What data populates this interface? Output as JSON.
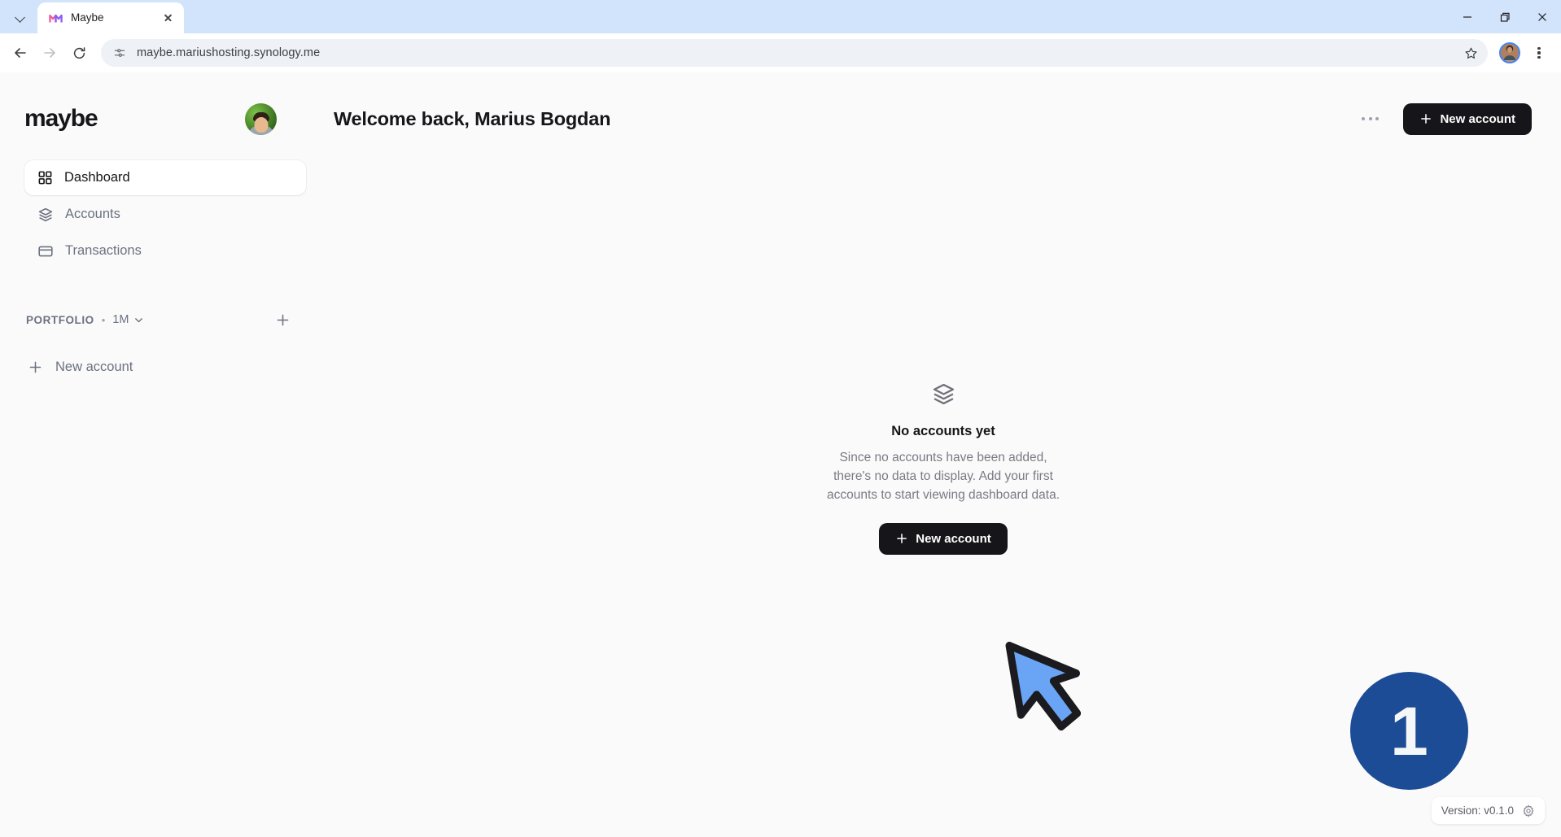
{
  "browser": {
    "tab": {
      "title": "Maybe",
      "favicon_icon": "maybe-logo-icon",
      "close_icon": "close-icon"
    },
    "tab_list_icon": "chevron-down-icon",
    "nav": {
      "back_icon": "back-arrow-icon",
      "forward_icon": "forward-arrow-icon",
      "reload_icon": "reload-icon"
    },
    "omnibox": {
      "site_info_icon": "site-settings-icon",
      "url": "maybe.mariushosting.synology.me",
      "bookmark_icon": "star-icon"
    },
    "profile_icon": "profile-avatar",
    "menu_icon": "three-dot-menu-icon",
    "window": {
      "minimize_icon": "minimize-icon",
      "maximize_icon": "restore-icon",
      "close_icon": "window-close-icon"
    }
  },
  "app": {
    "brand": "maybe",
    "avatar_icon": "user-avatar",
    "nav_items": [
      {
        "label": "Dashboard",
        "icon": "grid-icon",
        "active": true
      },
      {
        "label": "Accounts",
        "icon": "layers-icon",
        "active": false
      },
      {
        "label": "Transactions",
        "icon": "credit-card-icon",
        "active": false
      }
    ],
    "portfolio": {
      "title": "PORTFOLIO",
      "separator": "•",
      "period": "1M",
      "period_chevron_icon": "chevron-down-icon",
      "add_icon": "plus-icon"
    },
    "sidebar_new_account": {
      "label": "New account",
      "icon": "plus-icon"
    },
    "header": {
      "welcome": "Welcome back, Marius Bogdan",
      "overflow_icon": "ellipsis-icon",
      "new_account_button": {
        "label": "New account",
        "icon": "plus-icon"
      }
    },
    "empty_state": {
      "icon": "layers-icon",
      "title": "No accounts yet",
      "description": "Since no accounts have been added, there's no data to display. Add your first accounts to start viewing dashboard data.",
      "button": {
        "label": "New account",
        "icon": "plus-icon"
      }
    },
    "footer": {
      "version": "Version: v0.1.0",
      "settings_icon": "gear-icon"
    }
  },
  "annotation": {
    "step_number": "1",
    "badge_color": "#1d4c96",
    "cursor_color": "#6aa5f5",
    "cursor_icon": "arrow-cursor-icon"
  }
}
